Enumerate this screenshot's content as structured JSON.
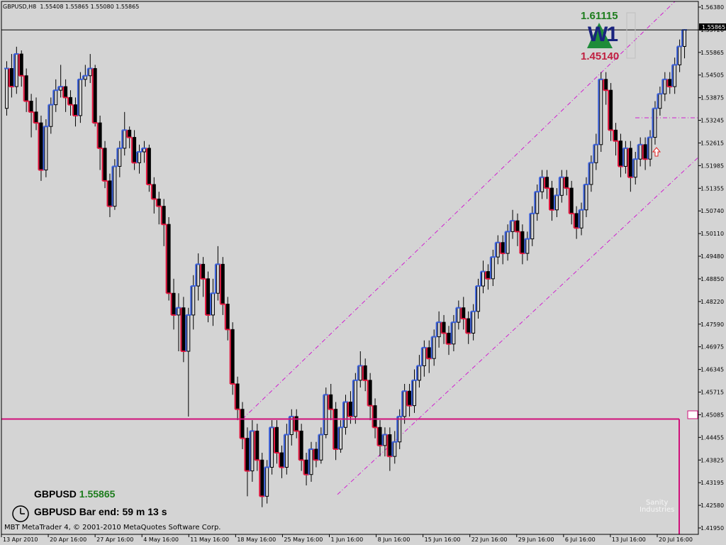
{
  "header": {
    "symbol_tf": "GBPUSD,H8",
    "ohlc": "1.55408 1.55865 1.55080 1.55865"
  },
  "footer": {
    "copyright": "MBT MetaTrader 4, © 2001-2010 MetaQuotes Software Corp."
  },
  "info": {
    "symbol": "GBPUSD",
    "price": "1.55865",
    "bar_end": "GBPUSD Bar end: 59 m 13 s"
  },
  "weekly": {
    "high": "1.61115",
    "label": "W1",
    "low": "1.45140"
  },
  "logo": {
    "line1": "Sanity",
    "line2": "Industries"
  },
  "colors": {
    "background": "#d4d4d4",
    "candle": "#000000",
    "up_line": "#3a5fd8",
    "down_line": "#e0143c",
    "channel": "#d020d0",
    "level": "#d0107a",
    "high_text": "#1e7d1e",
    "low_text": "#c02040"
  },
  "chart_data": {
    "type": "candlestick",
    "symbol": "GBPUSD",
    "timeframe": "H8",
    "ylim": [
      1.4195,
      1.5665
    ],
    "y_ticks": [
      "1.56380",
      "1.55720",
      "1.55865",
      "1.54505",
      "1.53875",
      "1.53245",
      "1.52615",
      "1.51985",
      "1.51355",
      "1.50740",
      "1.50110",
      "1.49480",
      "1.48850",
      "1.48220",
      "1.47590",
      "1.46975",
      "1.46345",
      "1.45715",
      "1.45085",
      "1.44455",
      "1.43825",
      "1.43195",
      "1.42580",
      "1.41950"
    ],
    "x_ticks": [
      "13 Apr 2010",
      "20 Apr 16:00",
      "27 Apr 16:00",
      "4 May 16:00",
      "11 May 16:00",
      "18 May 16:00",
      "25 May 16:00",
      "1 Jun 16:00",
      "8 Jun 16:00",
      "15 Jun 16:00",
      "22 Jun 16:00",
      "29 Jun 16:00",
      "6 Jul 16:00",
      "13 Jul 16:00",
      "20 Jul 16:00"
    ],
    "current_price": 1.55865,
    "horizontal_level": 1.4513,
    "candles": [
      [
        1.537,
        1.548,
        1.55,
        1.535
      ],
      [
        1.548,
        1.543,
        1.552,
        1.54
      ],
      [
        1.543,
        1.552,
        1.554,
        1.541
      ],
      [
        1.552,
        1.546,
        1.553,
        1.543
      ],
      [
        1.546,
        1.539,
        1.548,
        1.536
      ],
      [
        1.539,
        1.536,
        1.541,
        1.529
      ],
      [
        1.536,
        1.533,
        1.54,
        1.531
      ],
      [
        1.533,
        1.52,
        1.535,
        1.517
      ],
      [
        1.52,
        1.532,
        1.534,
        1.518
      ],
      [
        1.532,
        1.538,
        1.54,
        1.53
      ],
      [
        1.538,
        1.542,
        1.545,
        1.536
      ],
      [
        1.542,
        1.543,
        1.549,
        1.54
      ],
      [
        1.543,
        1.54,
        1.545,
        1.536
      ],
      [
        1.54,
        1.538,
        1.542,
        1.535
      ],
      [
        1.538,
        1.535,
        1.54,
        1.532
      ],
      [
        1.535,
        1.545,
        1.547,
        1.533
      ],
      [
        1.545,
        1.546,
        1.549,
        1.543
      ],
      [
        1.546,
        1.548,
        1.552,
        1.544
      ],
      [
        1.548,
        1.533,
        1.549,
        1.532
      ],
      [
        1.533,
        1.526,
        1.535,
        1.52
      ],
      [
        1.526,
        1.517,
        1.528,
        1.515
      ],
      [
        1.517,
        1.51,
        1.519,
        1.507
      ],
      [
        1.51,
        1.521,
        1.523,
        1.509
      ],
      [
        1.521,
        1.526,
        1.528,
        1.518
      ],
      [
        1.526,
        1.531,
        1.536,
        1.524
      ],
      [
        1.531,
        1.529,
        1.532,
        1.526
      ],
      [
        1.529,
        1.522,
        1.531,
        1.52
      ],
      [
        1.522,
        1.525,
        1.527,
        1.519
      ],
      [
        1.525,
        1.526,
        1.528,
        1.522
      ],
      [
        1.526,
        1.516,
        1.527,
        1.514
      ],
      [
        1.516,
        1.512,
        1.518,
        1.508
      ],
      [
        1.512,
        1.51,
        1.514,
        1.505
      ],
      [
        1.51,
        1.505,
        1.512,
        1.499
      ],
      [
        1.505,
        1.486,
        1.507,
        1.484
      ],
      [
        1.486,
        1.48,
        1.49,
        1.476
      ],
      [
        1.48,
        1.482,
        1.486,
        1.47
      ],
      [
        1.482,
        1.47,
        1.485,
        1.467
      ],
      [
        1.47,
        1.48,
        1.482,
        1.452
      ],
      [
        1.48,
        1.488,
        1.491,
        1.476
      ],
      [
        1.488,
        1.494,
        1.497,
        1.484
      ],
      [
        1.494,
        1.49,
        1.496,
        1.485
      ],
      [
        1.49,
        1.48,
        1.492,
        1.478
      ],
      [
        1.48,
        1.486,
        1.49,
        1.477
      ],
      [
        1.486,
        1.494,
        1.499,
        1.484
      ],
      [
        1.494,
        1.483,
        1.496,
        1.48
      ],
      [
        1.483,
        1.476,
        1.485,
        1.473
      ],
      [
        1.476,
        1.461,
        1.478,
        1.458
      ],
      [
        1.461,
        1.454,
        1.463,
        1.451
      ],
      [
        1.454,
        1.446,
        1.456,
        1.443
      ],
      [
        1.446,
        1.437,
        1.449,
        1.43
      ],
      [
        1.437,
        1.448,
        1.451,
        1.434
      ],
      [
        1.448,
        1.44,
        1.45,
        1.437
      ],
      [
        1.44,
        1.43,
        1.442,
        1.427
      ],
      [
        1.43,
        1.438,
        1.44,
        1.428
      ],
      [
        1.438,
        1.449,
        1.451,
        1.436
      ],
      [
        1.449,
        1.442,
        1.451,
        1.439
      ],
      [
        1.442,
        1.438,
        1.444,
        1.435
      ],
      [
        1.438,
        1.447,
        1.45,
        1.436
      ],
      [
        1.447,
        1.452,
        1.454,
        1.444
      ],
      [
        1.452,
        1.448,
        1.454,
        1.446
      ],
      [
        1.448,
        1.44,
        1.45,
        1.437
      ],
      [
        1.44,
        1.436,
        1.442,
        1.433
      ],
      [
        1.436,
        1.443,
        1.445,
        1.434
      ],
      [
        1.443,
        1.44,
        1.445,
        1.438
      ],
      [
        1.44,
        1.447,
        1.449,
        1.439
      ],
      [
        1.447,
        1.458,
        1.46,
        1.446
      ],
      [
        1.458,
        1.454,
        1.461,
        1.451
      ],
      [
        1.454,
        1.443,
        1.456,
        1.44
      ],
      [
        1.443,
        1.449,
        1.451,
        1.442
      ],
      [
        1.449,
        1.456,
        1.458,
        1.447
      ],
      [
        1.456,
        1.452,
        1.459,
        1.45
      ],
      [
        1.452,
        1.462,
        1.464,
        1.45
      ],
      [
        1.462,
        1.466,
        1.47,
        1.46
      ],
      [
        1.466,
        1.462,
        1.468,
        1.459
      ],
      [
        1.462,
        1.455,
        1.464,
        1.451
      ],
      [
        1.455,
        1.449,
        1.457,
        1.446
      ],
      [
        1.449,
        1.444,
        1.451,
        1.441
      ],
      [
        1.444,
        1.447,
        1.449,
        1.441
      ],
      [
        1.447,
        1.441,
        1.449,
        1.437
      ],
      [
        1.441,
        1.445,
        1.448,
        1.439
      ],
      [
        1.445,
        1.452,
        1.454,
        1.443
      ],
      [
        1.452,
        1.459,
        1.461,
        1.45
      ],
      [
        1.459,
        1.455,
        1.461,
        1.452
      ],
      [
        1.455,
        1.462,
        1.465,
        1.453
      ],
      [
        1.462,
        1.466,
        1.469,
        1.46
      ],
      [
        1.466,
        1.471,
        1.473,
        1.463
      ],
      [
        1.471,
        1.468,
        1.473,
        1.464
      ],
      [
        1.468,
        1.474,
        1.476,
        1.466
      ],
      [
        1.474,
        1.478,
        1.481,
        1.471
      ],
      [
        1.478,
        1.475,
        1.48,
        1.472
      ],
      [
        1.475,
        1.472,
        1.477,
        1.469
      ],
      [
        1.472,
        1.478,
        1.48,
        1.47
      ],
      [
        1.478,
        1.482,
        1.484,
        1.476
      ],
      [
        1.482,
        1.479,
        1.485,
        1.476
      ],
      [
        1.479,
        1.475,
        1.481,
        1.472
      ],
      [
        1.475,
        1.481,
        1.483,
        1.473
      ],
      [
        1.481,
        1.488,
        1.49,
        1.479
      ],
      [
        1.488,
        1.492,
        1.495,
        1.486
      ],
      [
        1.492,
        1.49,
        1.494,
        1.487
      ],
      [
        1.49,
        1.496,
        1.498,
        1.488
      ],
      [
        1.496,
        1.5,
        1.502,
        1.494
      ],
      [
        1.5,
        1.497,
        1.502,
        1.494
      ],
      [
        1.497,
        1.503,
        1.505,
        1.495
      ],
      [
        1.503,
        1.506,
        1.509,
        1.501
      ],
      [
        1.506,
        1.503,
        1.508,
        1.499
      ],
      [
        1.503,
        1.497,
        1.505,
        1.494
      ],
      [
        1.497,
        1.501,
        1.503,
        1.495
      ],
      [
        1.501,
        1.508,
        1.51,
        1.499
      ],
      [
        1.508,
        1.514,
        1.516,
        1.506
      ],
      [
        1.514,
        1.518,
        1.52,
        1.512
      ],
      [
        1.518,
        1.515,
        1.52,
        1.512
      ],
      [
        1.515,
        1.509,
        1.517,
        1.506
      ],
      [
        1.509,
        1.513,
        1.515,
        1.507
      ],
      [
        1.513,
        1.518,
        1.52,
        1.511
      ],
      [
        1.518,
        1.515,
        1.52,
        1.513
      ],
      [
        1.515,
        1.508,
        1.517,
        1.505
      ],
      [
        1.508,
        1.504,
        1.51,
        1.501
      ],
      [
        1.504,
        1.509,
        1.511,
        1.502
      ],
      [
        1.509,
        1.516,
        1.518,
        1.507
      ],
      [
        1.516,
        1.522,
        1.524,
        1.514
      ],
      [
        1.522,
        1.527,
        1.53,
        1.52
      ],
      [
        1.527,
        1.545,
        1.547,
        1.525
      ],
      [
        1.545,
        1.542,
        1.547,
        1.538
      ],
      [
        1.542,
        1.531,
        1.544,
        1.528
      ],
      [
        1.531,
        1.528,
        1.533,
        1.524
      ],
      [
        1.528,
        1.521,
        1.53,
        1.518
      ],
      [
        1.521,
        1.526,
        1.528,
        1.519
      ],
      [
        1.526,
        1.518,
        1.528,
        1.514
      ],
      [
        1.518,
        1.523,
        1.525,
        1.516
      ],
      [
        1.523,
        1.527,
        1.529,
        1.521
      ],
      [
        1.527,
        1.523,
        1.529,
        1.52
      ],
      [
        1.523,
        1.529,
        1.531,
        1.521
      ],
      [
        1.529,
        1.537,
        1.539,
        1.527
      ],
      [
        1.537,
        1.541,
        1.543,
        1.535
      ],
      [
        1.541,
        1.545,
        1.547,
        1.539
      ],
      [
        1.545,
        1.543,
        1.547,
        1.541
      ],
      [
        1.543,
        1.549,
        1.551,
        1.541
      ],
      [
        1.549,
        1.55408,
        1.556,
        1.547
      ],
      [
        1.55408,
        1.55865,
        1.55865,
        1.5508
      ]
    ],
    "channel_upper": [
      [
        1.4513,
        1.5665
      ]
    ],
    "channel_lower": [
      [
        1.4305,
        1.5235
      ]
    ]
  }
}
